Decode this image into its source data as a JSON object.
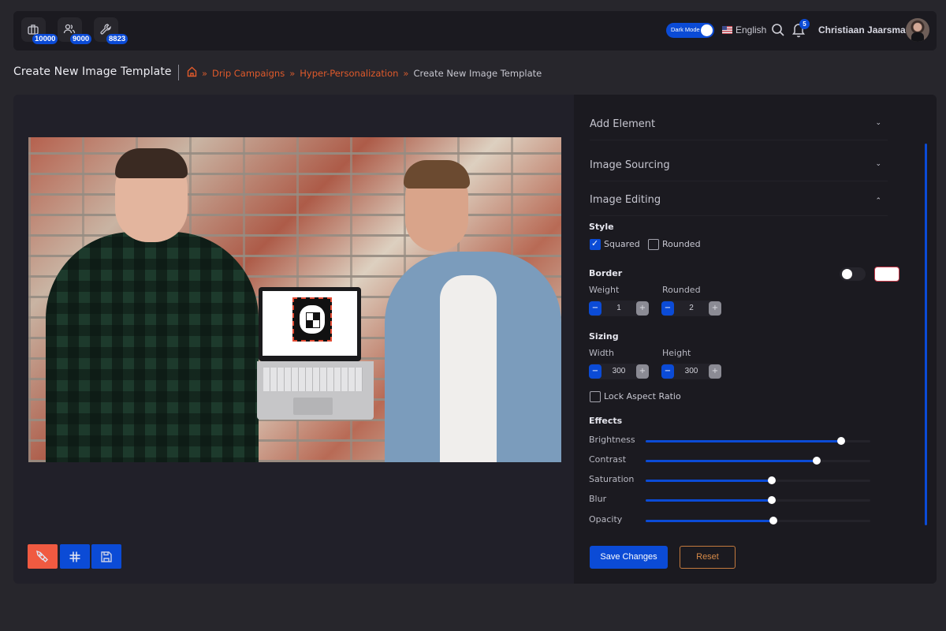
{
  "topbar": {
    "stats": [
      {
        "icon": "briefcase-icon",
        "count": "10000"
      },
      {
        "icon": "users-icon",
        "count": "9000"
      },
      {
        "icon": "wrench-icon",
        "count": "8823"
      }
    ],
    "dark_mode_label": "Dark Mode",
    "dark_mode_on": true,
    "language": "English",
    "notifications_count": "5",
    "user_name": "Christiaan Jaarsma"
  },
  "header": {
    "title": "Create New Image Template",
    "breadcrumb": [
      {
        "label": "Drip Campaigns",
        "link": true
      },
      {
        "label": "Hyper-Personalization",
        "link": true
      },
      {
        "label": "Create New Image Template",
        "link": false
      }
    ],
    "separator": "»"
  },
  "canvas": {
    "image_alt": "Two men in front of a brick wall with a laptop showing a logo",
    "tools": [
      {
        "icon": "pen-tool-icon",
        "color": "#f05a41"
      },
      {
        "icon": "hashtag-icon",
        "color": "#0b4bd6"
      },
      {
        "icon": "floppy-disk-icon",
        "color": "#0b4bd6"
      }
    ]
  },
  "panel": {
    "sections": [
      {
        "label": "Add Element",
        "expanded": false,
        "chevron": "⌄"
      },
      {
        "label": "Image Sourcing",
        "expanded": false,
        "chevron": "⌄"
      },
      {
        "label": "Image Editing",
        "expanded": true,
        "chevron": "⌃"
      }
    ],
    "style": {
      "title": "Style",
      "options": [
        {
          "label": "Squared",
          "checked": true
        },
        {
          "label": "Rounded",
          "checked": false
        }
      ]
    },
    "border": {
      "title": "Border",
      "enabled": false,
      "color": "#ffffff",
      "weight_label": "Weight",
      "weight_value": "1",
      "rounded_label": "Rounded",
      "rounded_value": "2"
    },
    "sizing": {
      "title": "Sizing",
      "width_label": "Width",
      "width_value": "300",
      "height_label": "Height",
      "height_value": "300",
      "lock_label": "Lock Aspect Ratio",
      "lock_checked": false
    },
    "effects": {
      "title": "Effects",
      "sliders": [
        {
          "label": "Brightness",
          "value_pct": 87
        },
        {
          "label": "Contrast",
          "value_pct": 76
        },
        {
          "label": "Saturation",
          "value_pct": 56
        },
        {
          "label": "Blur",
          "value_pct": 56
        },
        {
          "label": "Opacity",
          "value_pct": 57
        }
      ]
    },
    "save_label": "Save Changes",
    "reset_label": "Reset"
  },
  "colors": {
    "accent_blue": "#0b4bd6",
    "accent_orange": "#e05a2b",
    "pen_red": "#f05a41"
  }
}
